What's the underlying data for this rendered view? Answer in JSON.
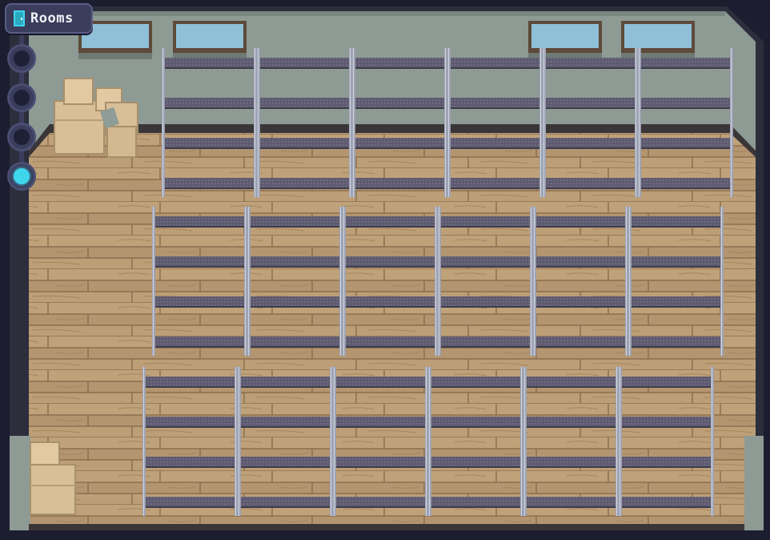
{
  "rooms_button": {
    "label": "Rooms",
    "icon": "door-icon"
  },
  "room_selector": {
    "node_count": 4,
    "active_index": 3
  },
  "colors": {
    "accent": "#3fd6ec",
    "panel": "#3a3d5c",
    "wall": "#8e9a94",
    "floor": "#b99c74",
    "shelf_bar": "#5e5a70"
  },
  "warehouse": {
    "shelf_rows": 3,
    "shelves_per_row": 6,
    "windows": 4,
    "box_stacks": 2
  }
}
